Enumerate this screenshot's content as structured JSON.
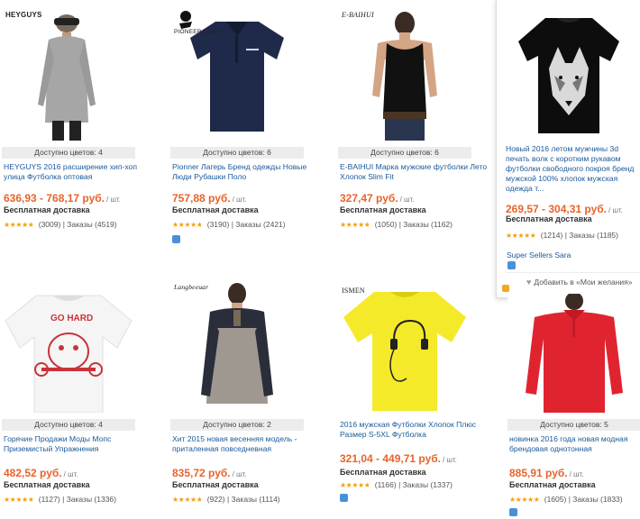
{
  "products": [
    {
      "brand": "HEYGUYS",
      "colors": "Доступно цветов: 4",
      "title": "HEYGUYS 2016 расширение хип-хоп улица Футболка оптовая",
      "price": "636,93 - 768,17 руб.",
      "unit": "/ шт.",
      "shipping": "Бесплатная доставка",
      "reviews": "(3009)",
      "orders": "Заказы (4519)"
    },
    {
      "brand": "PIONEER CAMP",
      "colors": "Доступно цветов: 6",
      "title": "Pionner Лагерь Бренд одежды Новые Люди Рубашки Поло",
      "price": "757,88 руб.",
      "unit": "/ шт.",
      "shipping": "Бесплатная доставка",
      "reviews": "(3190)",
      "orders": "Заказы (2421)"
    },
    {
      "brand": "E-BAIHUI",
      "colors": "Доступно цветов: 6",
      "title": "E-BAIHUI Марка мужские футболки Лето Хлопок Slim Fit",
      "price": "327,47 руб.",
      "unit": "/ шт.",
      "shipping": "Бесплатная доставка",
      "reviews": "(1050)",
      "orders": "Заказы (1162)"
    },
    {
      "brand": "",
      "colors": "",
      "title": "Новый 2016 летом мужчины 3d печать волк с коротким рукавом футболки свободного покроя бренд мужской 100% хлопок мужская одежда т...",
      "price": "269,57 - 304,31 руб.",
      "unit": "/ шт.",
      "shipping": "Бесплатная доставка",
      "reviews": "(1214)",
      "orders": "Заказы (1185)",
      "seller": "Super Sellers Sara",
      "wishlist": "Добавить в «Мои желания»"
    },
    {
      "brand": "",
      "colors": "Доступно цветов: 4",
      "title": "Горячие Продажи Моды Мопс Приземистый Упражнения",
      "price": "482,52 руб.",
      "unit": "/ шт.",
      "shipping": "Бесплатная доставка",
      "reviews": "(1127)",
      "orders": "Заказы (1336)",
      "print_text": "GO HARD"
    },
    {
      "brand": "Langbeeuar",
      "colors": "Доступно цветов: 2",
      "title": "Хит 2015 новая весенняя модель - приталенная повседневная",
      "price": "835,72 руб.",
      "unit": "/ шт.",
      "shipping": "Бесплатная доставка",
      "reviews": "(922)",
      "orders": "Заказы (1114)"
    },
    {
      "brand": "ISMEN",
      "colors": "",
      "title": "2016 мужская Футболки Хлопок Плюс Размер S-5XL Футболка",
      "price": "321,04 - 449,71 руб.",
      "unit": "/ шт.",
      "shipping": "Бесплатная доставка",
      "reviews": "(1166)",
      "orders": "Заказы (1337)"
    },
    {
      "brand": "",
      "colors": "Доступно цветов: 5",
      "title": "новинка 2016 года новая модная брендовая однотонная",
      "price": "885,91 руб.",
      "unit": "/ шт.",
      "shipping": "Бесплатная доставка",
      "reviews": "(1605)",
      "orders": "Заказы (1833)"
    }
  ],
  "separator": "|",
  "stars": "★★★★★",
  "colors_theme": {
    "price": "#e8632b",
    "title_link": "#1a5a9a",
    "stars": "#f3a012"
  }
}
